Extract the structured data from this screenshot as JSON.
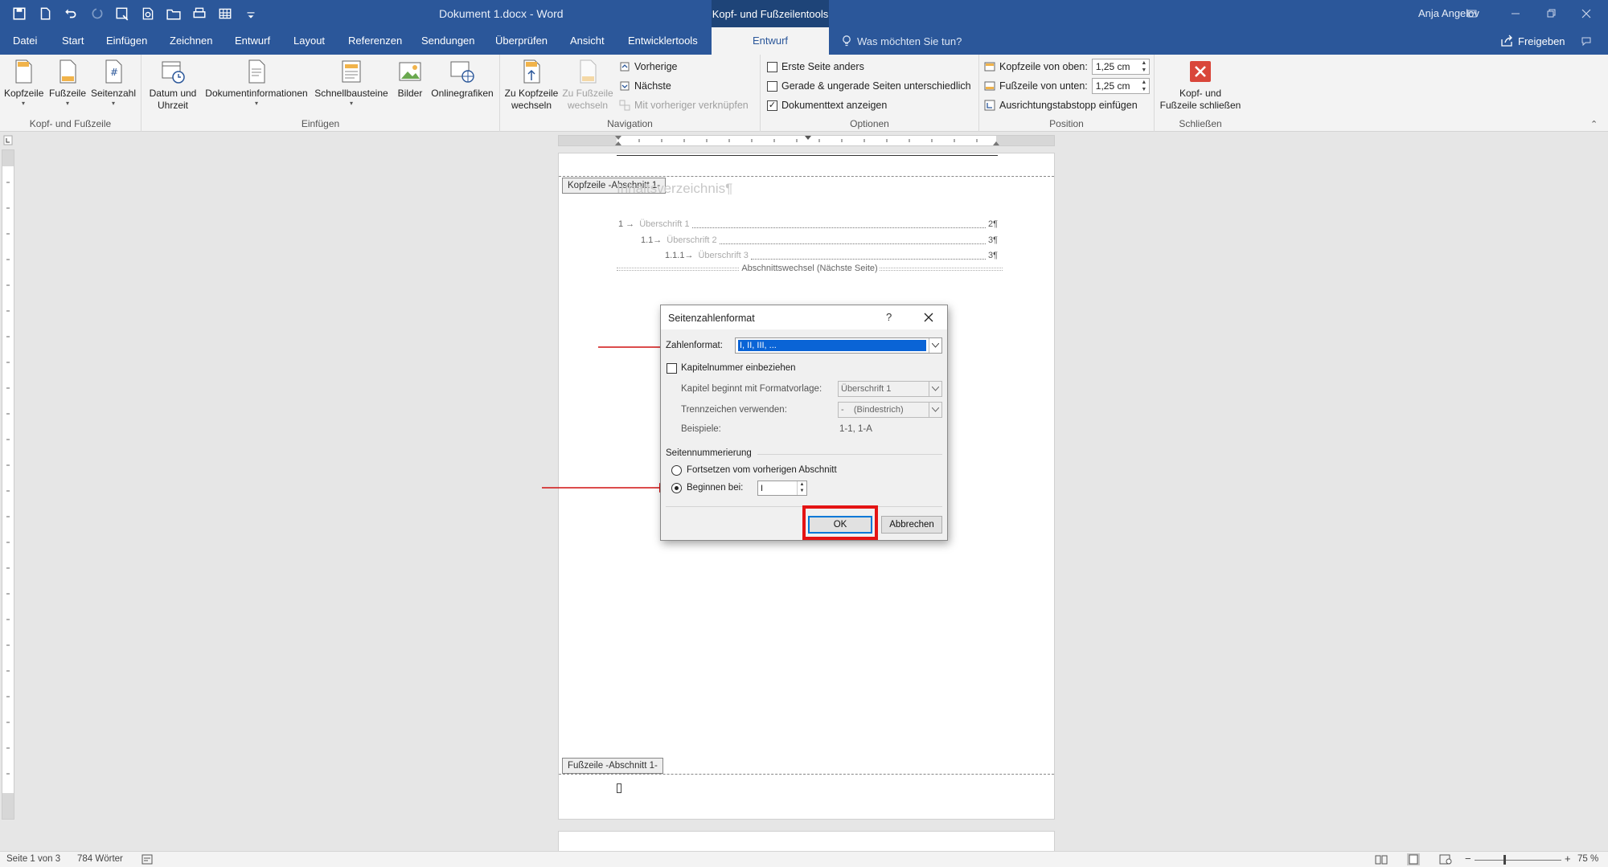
{
  "window": {
    "title": "Dokument 1.docx  -  Word",
    "contextual_tab": "Kopf- und Fußzeilentools",
    "user": "Anja Angelov"
  },
  "tabs": [
    "Datei",
    "Start",
    "Einfügen",
    "Zeichnen",
    "Entwurf",
    "Layout",
    "Referenzen",
    "Sendungen",
    "Überprüfen",
    "Ansicht",
    "Entwicklertools",
    "Entwurf"
  ],
  "tell_me": "Was möchten Sie tun?",
  "share": "Freigeben",
  "ribbon": {
    "groups": {
      "kopf_fuss": "Kopf- und Fußzeile",
      "einfuegen": "Einfügen",
      "navigation": "Navigation",
      "optionen": "Optionen",
      "position": "Position",
      "schliessen": "Schließen"
    },
    "kopfzeile": "Kopfzeile",
    "fusszeile": "Fußzeile",
    "seitenzahl": "Seitenzahl",
    "datum_1": "Datum und",
    "datum_2": "Uhrzeit",
    "dokinfo": "Dokumentinformationen",
    "schnellbausteine": "Schnellbausteine",
    "bilder": "Bilder",
    "onlinegrafiken": "Onlinegrafiken",
    "zu_kopf_1": "Zu Kopfzeile",
    "zu_kopf_2": "wechseln",
    "zu_fuss_1": "Zu Fußzeile",
    "zu_fuss_2": "wechseln",
    "vorherige": "Vorherige",
    "naechste": "Nächste",
    "verknuepfen": "Mit vorheriger verknüpfen",
    "erste_seite": "Erste Seite anders",
    "gerade_ungerade": "Gerade & ungerade Seiten unterschiedlich",
    "dokumenttext": "Dokumenttext anzeigen",
    "kopf_oben_label": "Kopfzeile von oben:",
    "kopf_oben_value": "1,25 cm",
    "fuss_unten_label": "Fußzeile von unten:",
    "fuss_unten_value": "1,25 cm",
    "ausrichtung": "Ausrichtungstabstopp einfügen",
    "schliessen_1": "Kopf- und",
    "schliessen_2": "Fußzeile schließen"
  },
  "document": {
    "header_tag": "Kopfzeile -Abschnitt 1-",
    "footer_tag": "Fußzeile -Abschnitt 1-",
    "toc_heading": "Inhaltsverzeichnis¶",
    "toc": [
      {
        "num": "1 →",
        "text": "Überschrift 1",
        "page": "2¶"
      },
      {
        "num": "1.1→",
        "text": "Überschrift 2",
        "page": "3¶"
      },
      {
        "num": "1.1.1→",
        "text": "Überschrift 3",
        "page": "3¶"
      }
    ],
    "section_break": "Abschnittswechsel (Nächste Seite)"
  },
  "dialog": {
    "title": "Seitenzahlenformat",
    "help": "?",
    "zahlenformat_label": "Zahlenformat:",
    "zahlenformat_value": "I, II, III, ...",
    "kapitelnummer": "Kapitelnummer einbeziehen",
    "kapitel_beginnt_label": "Kapitel beginnt mit Formatvorlage:",
    "kapitel_beginnt_value": "Überschrift 1",
    "trennzeichen_label": "Trennzeichen verwenden:",
    "trennzeichen_value": "-    (Bindestrich)",
    "beispiele_label": "Beispiele:",
    "beispiele_value": "1-1, 1-A",
    "seitennummerierung": "Seitennummerierung",
    "fortsetzen": "Fortsetzen vom vorherigen Abschnitt",
    "beginnen_label": "Beginnen bei:",
    "beginnen_value": "I",
    "ok": "OK",
    "abbrechen": "Abbrechen"
  },
  "statusbar": {
    "page": "Seite 1 von 3",
    "words": "784 Wörter",
    "zoom": "75 %"
  },
  "colors": {
    "word_blue": "#2b579a",
    "annotation_red": "#e41414",
    "selection_blue": "#0a64d6"
  }
}
